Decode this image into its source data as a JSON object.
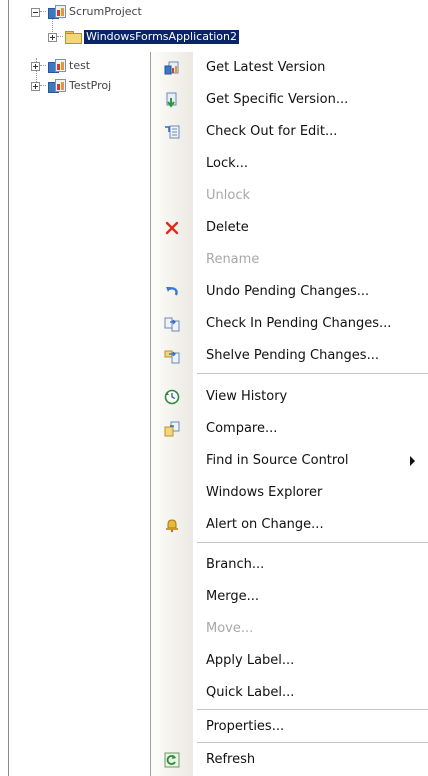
{
  "tree": {
    "items": [
      {
        "label": "ScrumProject"
      },
      {
        "label": "WindowsFormsApplication2"
      },
      {
        "label": "test"
      },
      {
        "label": "TestProj"
      }
    ]
  },
  "menu": {
    "items": [
      {
        "label": "Get Latest Version",
        "icon": "get-latest-icon",
        "enabled": true
      },
      {
        "label": "Get Specific Version...",
        "icon": "get-specific-icon",
        "enabled": true
      },
      {
        "label": "Check Out for Edit...",
        "icon": "checkout-icon",
        "enabled": true
      },
      {
        "label": "Lock...",
        "icon": "",
        "enabled": true
      },
      {
        "label": "Unlock",
        "icon": "",
        "enabled": false
      },
      {
        "label": "Delete",
        "icon": "delete-icon",
        "enabled": true
      },
      {
        "label": "Rename",
        "icon": "",
        "enabled": false
      },
      {
        "label": "Undo Pending Changes...",
        "icon": "undo-icon",
        "enabled": true
      },
      {
        "label": "Check In Pending Changes...",
        "icon": "checkin-icon",
        "enabled": true
      },
      {
        "label": "Shelve Pending Changes...",
        "icon": "shelve-icon",
        "enabled": true
      },
      {
        "label": "View History",
        "icon": "history-icon",
        "enabled": true
      },
      {
        "label": "Compare...",
        "icon": "compare-icon",
        "enabled": true
      },
      {
        "label": "Find in Source Control",
        "icon": "",
        "enabled": true,
        "submenu": true
      },
      {
        "label": "Windows Explorer",
        "icon": "",
        "enabled": true
      },
      {
        "label": "Alert on Change...",
        "icon": "bell-icon",
        "enabled": true
      },
      {
        "label": "Branch...",
        "icon": "",
        "enabled": true
      },
      {
        "label": "Merge...",
        "icon": "",
        "enabled": true
      },
      {
        "label": "Move...",
        "icon": "",
        "enabled": false
      },
      {
        "label": "Apply Label...",
        "icon": "",
        "enabled": true
      },
      {
        "label": "Quick Label...",
        "icon": "",
        "enabled": true
      },
      {
        "label": "Properties...",
        "icon": "",
        "enabled": true
      },
      {
        "label": "Refresh",
        "icon": "refresh-icon",
        "enabled": true
      }
    ]
  },
  "colors": {
    "selection": "#0a246a",
    "delete_red": "#e02a1a"
  }
}
